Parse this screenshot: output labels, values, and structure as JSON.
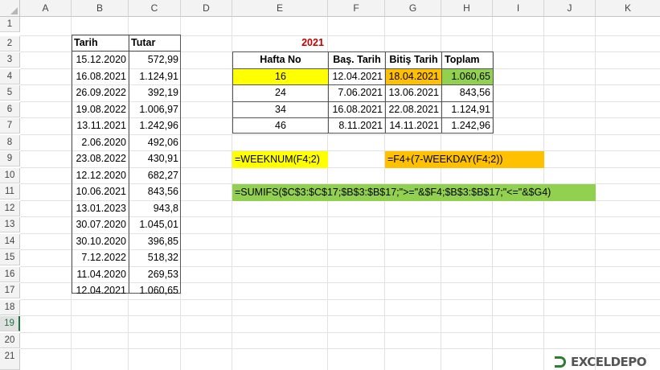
{
  "columns": [
    "A",
    "B",
    "C",
    "D",
    "E",
    "F",
    "G",
    "H",
    "I",
    "J",
    "K"
  ],
  "rows": [
    "1",
    "2",
    "3",
    "4",
    "5",
    "6",
    "7",
    "8",
    "9",
    "10",
    "11",
    "12",
    "13",
    "14",
    "15",
    "16",
    "17",
    "18",
    "19",
    "20",
    "21"
  ],
  "left_table": {
    "headers": [
      "Tarih",
      "Tutar"
    ],
    "rows": [
      [
        "15.12.2020",
        "572,99"
      ],
      [
        "16.08.2021",
        "1.124,91"
      ],
      [
        "26.09.2022",
        "392,19"
      ],
      [
        "19.08.2022",
        "1.006,97"
      ],
      [
        "13.11.2021",
        "1.242,96"
      ],
      [
        "2.06.2020",
        "492,06"
      ],
      [
        "23.08.2022",
        "430,91"
      ],
      [
        "12.12.2020",
        "682,27"
      ],
      [
        "10.06.2021",
        "843,56"
      ],
      [
        "13.01.2023",
        "943,8"
      ],
      [
        "30.07.2020",
        "1.045,01"
      ],
      [
        "30.10.2020",
        "396,85"
      ],
      [
        "7.12.2022",
        "518,32"
      ],
      [
        "11.04.2020",
        "269,53"
      ],
      [
        "12.04.2021",
        "1.060,65"
      ]
    ]
  },
  "year_label": "2021",
  "right_table": {
    "headers": [
      "Hafta No",
      "Baş. Tarih",
      "Bitiş Tarih",
      "Toplam"
    ],
    "rows": [
      [
        "16",
        "12.04.2021",
        "18.04.2021",
        "1.060,65"
      ],
      [
        "24",
        "7.06.2021",
        "13.06.2021",
        "843,56"
      ],
      [
        "34",
        "16.08.2021",
        "22.08.2021",
        "1.124,91"
      ],
      [
        "46",
        "8.11.2021",
        "14.11.2021",
        "1.242,96"
      ]
    ]
  },
  "formulas": {
    "weeknum": "=WEEKNUM(F4;2)",
    "end_date": "=F4+(7-WEEKDAY(F4;2))",
    "sumifs": "=SUMIFS($C$3:$C$17;$B$3:$B$17;\">=\"&$F4;$B$3:$B$17;\"<=\"&$G4)"
  },
  "colors": {
    "yellow": "#ffff00",
    "orange": "#ffc000",
    "green": "#92d050",
    "red_title": "#c00000",
    "selection": "#217346"
  },
  "watermark": {
    "icon": "logo-bracket-icon",
    "text": "EXCELDEPO"
  }
}
